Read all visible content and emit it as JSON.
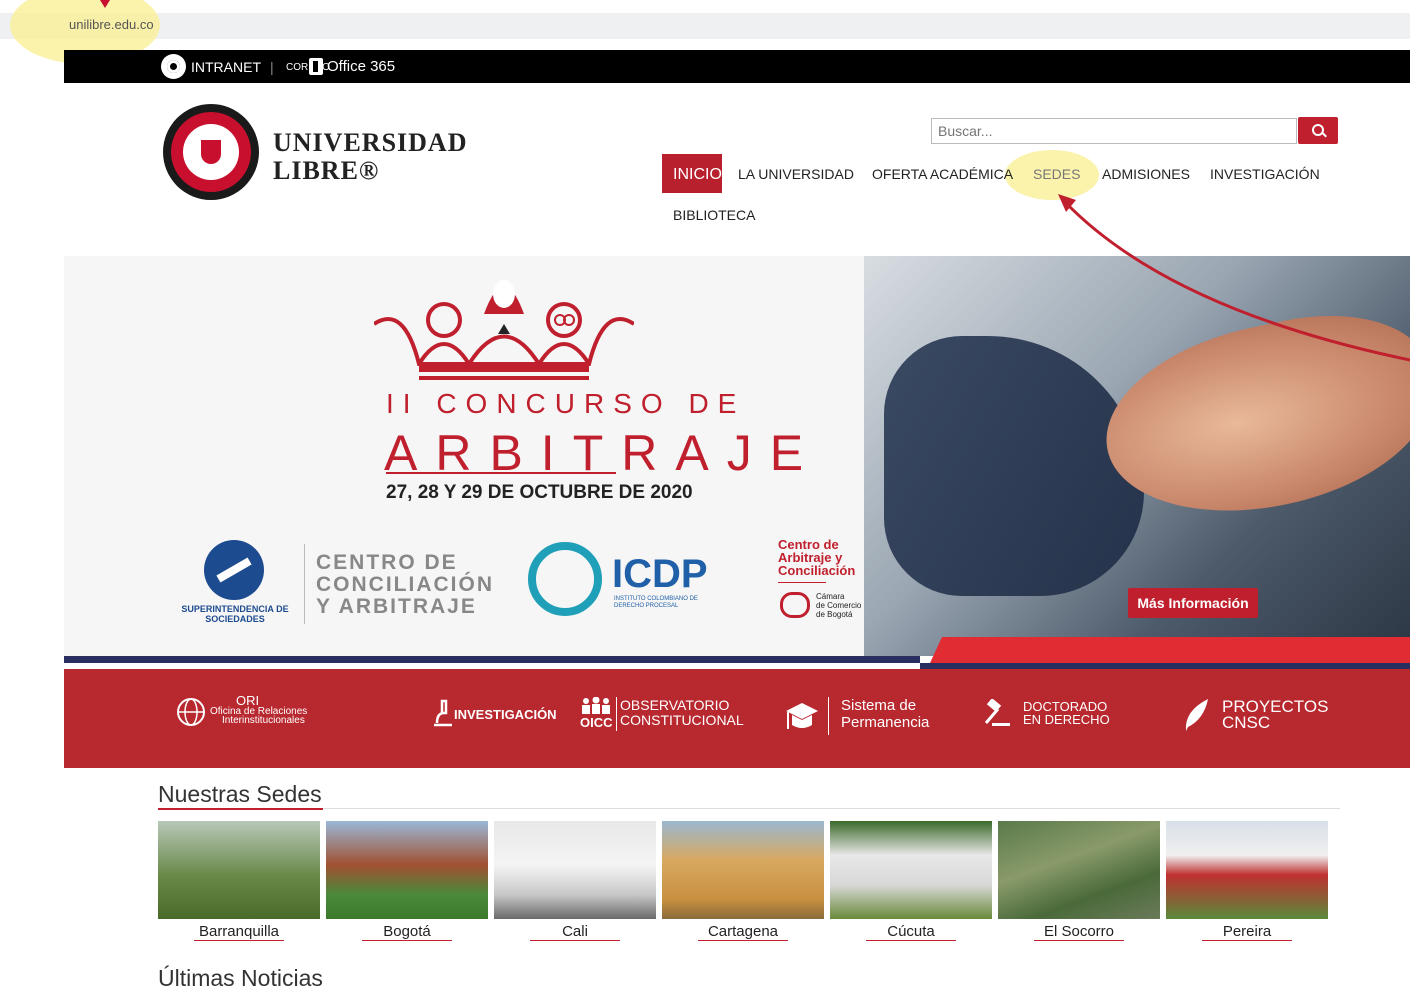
{
  "browser": {
    "url": "unilibre.edu.co"
  },
  "topbar": {
    "intranet": "INTRANET",
    "separator": "|",
    "correo": "CORREO",
    "office": "Office 365"
  },
  "brand": {
    "line1": "UNIVERSIDAD",
    "line2": "LIBRE®"
  },
  "search": {
    "placeholder": "Buscar...",
    "icon": "search-icon"
  },
  "nav": {
    "inicio": "INICIO",
    "universidad": "LA UNIVERSIDAD",
    "oferta": "OFERTA ACADÉMICA",
    "sedes": "SEDES",
    "admisiones": "ADMISIONES",
    "investigacion": "INVESTIGACIÓN",
    "biblioteca": "BIBLIOTECA"
  },
  "banner": {
    "title_line1": "II CONCURSO DE",
    "title_line2": "ARBITRAJE",
    "date": "27, 28 Y 29 DE OCTUBRE DE 2020",
    "supersoc": "SUPERINTENDENCIA DE SOCIEDADES",
    "centro": [
      "CENTRO DE",
      "CONCILIACIÓN",
      "Y ARBITRAJE"
    ],
    "icdp": "ICDP",
    "icdp_sub": "INSTITUTO COLOMBIANO DE DERECHO PROCESAL",
    "cac": [
      "Centro de",
      "Arbitraje y",
      "Conciliación"
    ],
    "cac_sub": [
      "Cámara",
      "de Comercio",
      "de Bogotá"
    ],
    "button": "Más Información"
  },
  "quicklinks": {
    "ori_title": "ORI",
    "ori_sub1": "Oficina de Relaciones",
    "ori_sub2": "Interinstitucionales",
    "investigacion": "INVESTIGACIÓN",
    "oicc_abbr": "OICC",
    "oicc_line1": "OBSERVATORIO",
    "oicc_line2": "CONSTITUCIONAL",
    "permanencia_1": "Sistema de",
    "permanencia_2": "Permanencia",
    "doctorado_1": "DOCTORADO",
    "doctorado_2": "EN DERECHO",
    "cnsc_1": "PROYECTOS",
    "cnsc_2": "CNSC"
  },
  "sedes": {
    "title": "Nuestras Sedes",
    "items": [
      "Barranquilla",
      "Bogotá",
      "Cali",
      "Cartagena",
      "Cúcuta",
      "El Socorro",
      "Pereira"
    ]
  },
  "news": {
    "title": "Últimas Noticias"
  },
  "colors": {
    "brand_red": "#b8202e",
    "navy": "#2a2d60",
    "highlight": "#faf096"
  }
}
